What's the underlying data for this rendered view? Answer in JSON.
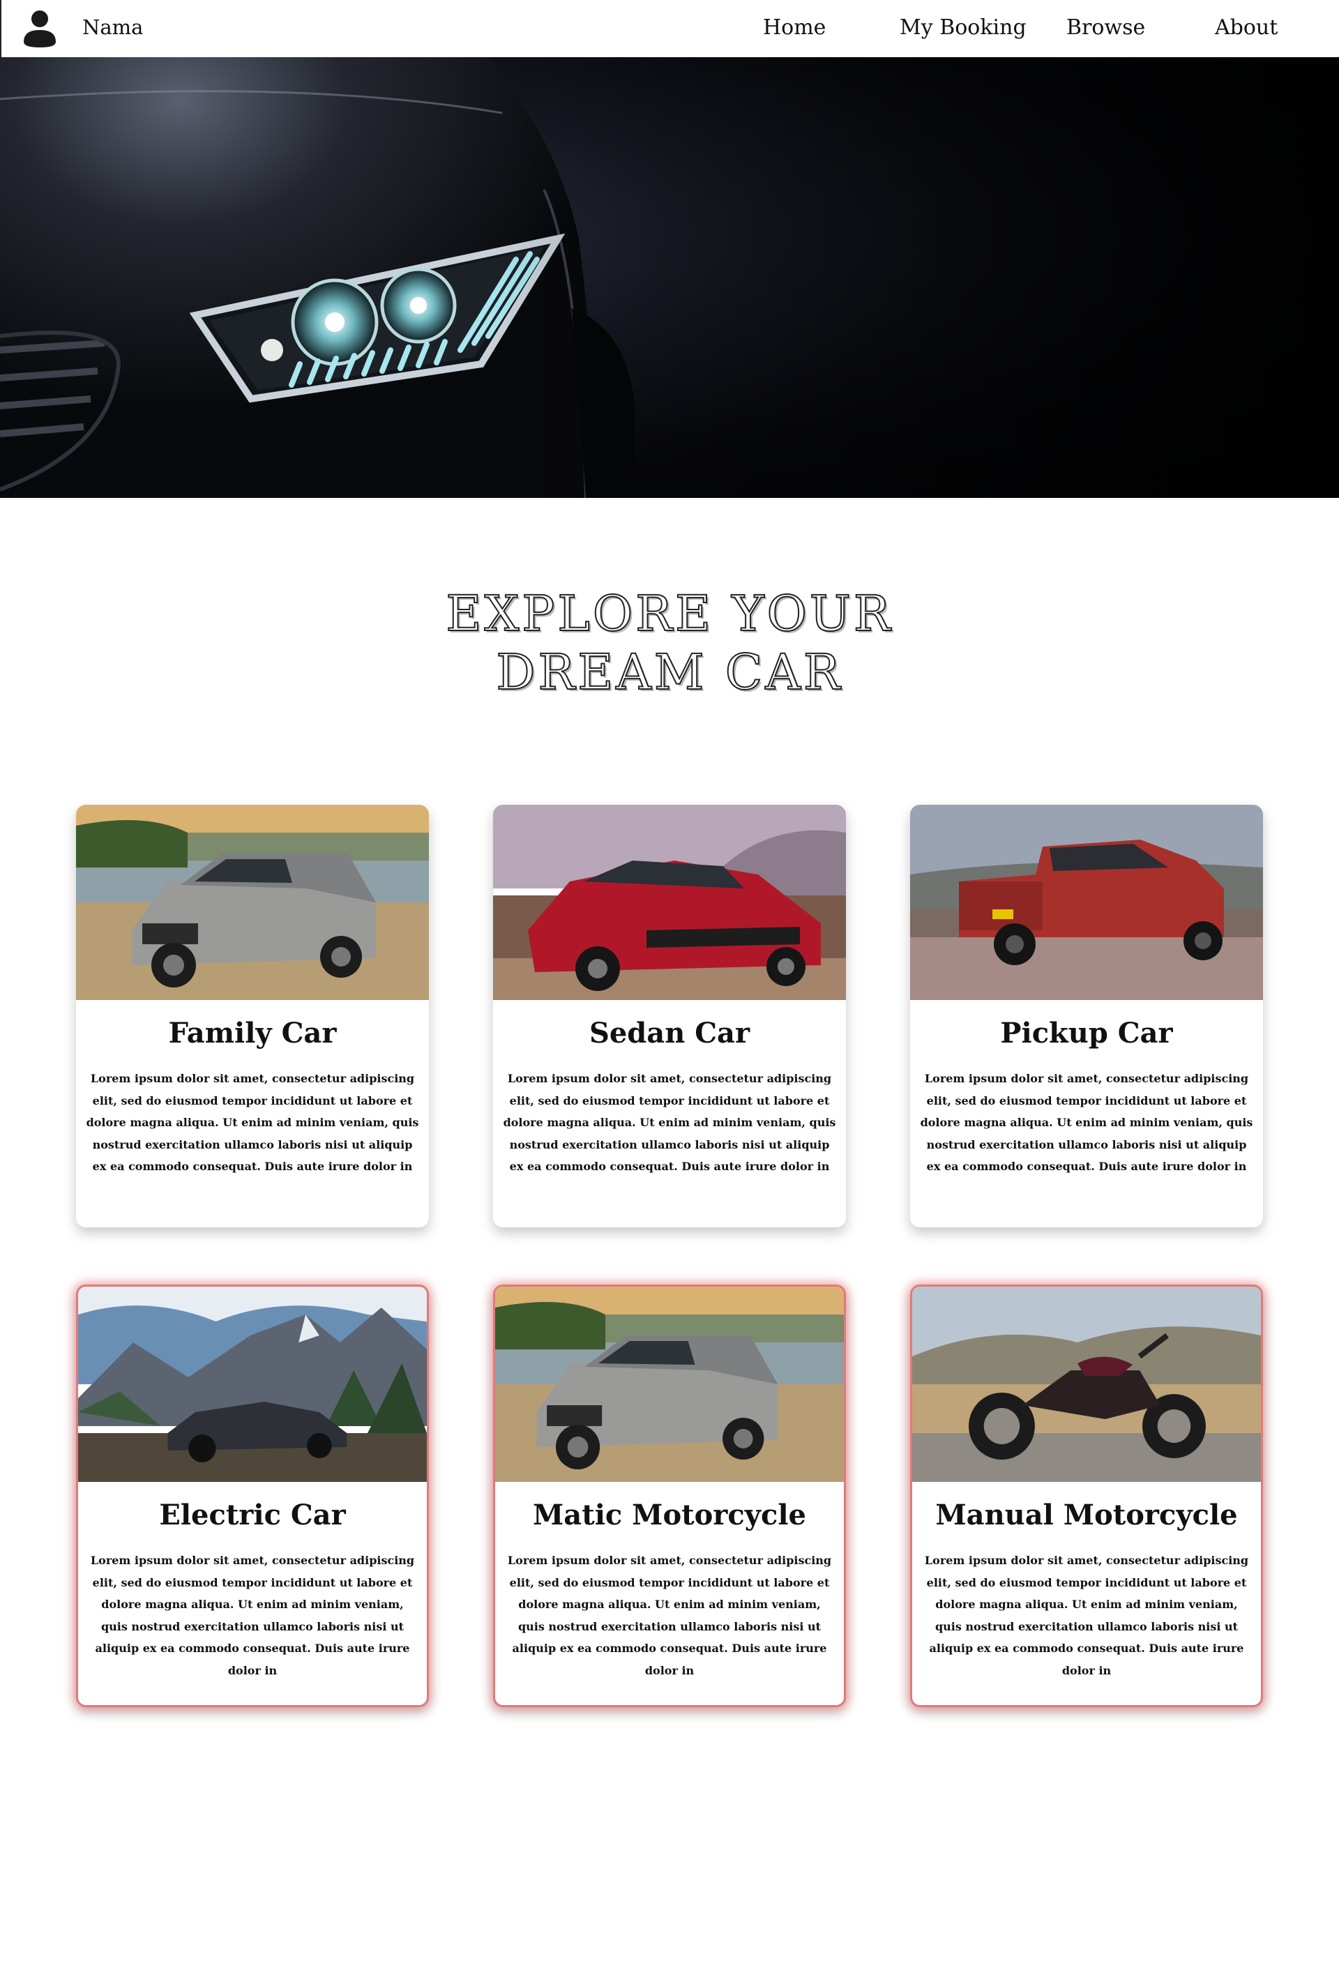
{
  "nav": {
    "brand": "Nama",
    "items": [
      "Home",
      "My Booking",
      "Browse",
      "About"
    ]
  },
  "heading": {
    "line1": "EXPLORE YOUR",
    "line2": "DREAM CAR"
  },
  "cards": [
    {
      "title": "Family Car",
      "text": "Lorem ipsum dolor sit amet, consectetur adipiscing elit, sed do eiusmod tempor incididunt ut labore et dolore magna aliqua. Ut enim ad minim veniam, quis nostrud exercitation ullamco laboris nisi ut aliquip ex ea commodo consequat. Duis aute irure dolor in"
    },
    {
      "title": "Sedan Car",
      "text": "Lorem ipsum dolor sit amet, consectetur adipiscing elit, sed do eiusmod tempor incididunt ut labore et dolore magna aliqua. Ut enim ad minim veniam, quis nostrud exercitation ullamco laboris nisi ut aliquip ex ea commodo consequat. Duis aute irure dolor in"
    },
    {
      "title": "Pickup Car",
      "text": "Lorem ipsum dolor sit amet, consectetur adipiscing elit, sed do eiusmod tempor incididunt ut labore et dolore magna aliqua. Ut enim ad minim veniam, quis nostrud exercitation ullamco laboris nisi ut aliquip ex ea commodo consequat. Duis aute irure dolor in"
    },
    {
      "title": "Electric Car",
      "text": "Lorem ipsum dolor sit amet, consectetur adipiscing elit, sed do eiusmod tempor incididunt ut labore et dolore magna aliqua. Ut enim ad minim veniam, quis nostrud exercitation ullamco laboris nisi ut aliquip ex ea commodo consequat. Duis aute irure dolor in"
    },
    {
      "title": "Matic Motorcycle",
      "text": "Lorem ipsum dolor sit amet, consectetur adipiscing elit, sed do eiusmod tempor incididunt ut labore et dolore magna aliqua. Ut enim ad minim veniam, quis nostrud exercitation ullamco laboris nisi ut aliquip ex ea commodo consequat. Duis aute irure dolor in"
    },
    {
      "title": "Manual Motorcycle",
      "text": "Lorem ipsum dolor sit amet, consectetur adipiscing elit, sed do eiusmod tempor incididunt ut labore et dolore magna aliqua. Ut enim ad minim veniam, quis nostrud exercitation ullamco laboris nisi ut aliquip ex ea commodo consequat. Duis aute irure dolor in"
    }
  ],
  "colors": {
    "glow": "#e07a7a",
    "hero_dark": "#020203"
  },
  "icons": {
    "avatar": "user-avatar-icon"
  }
}
